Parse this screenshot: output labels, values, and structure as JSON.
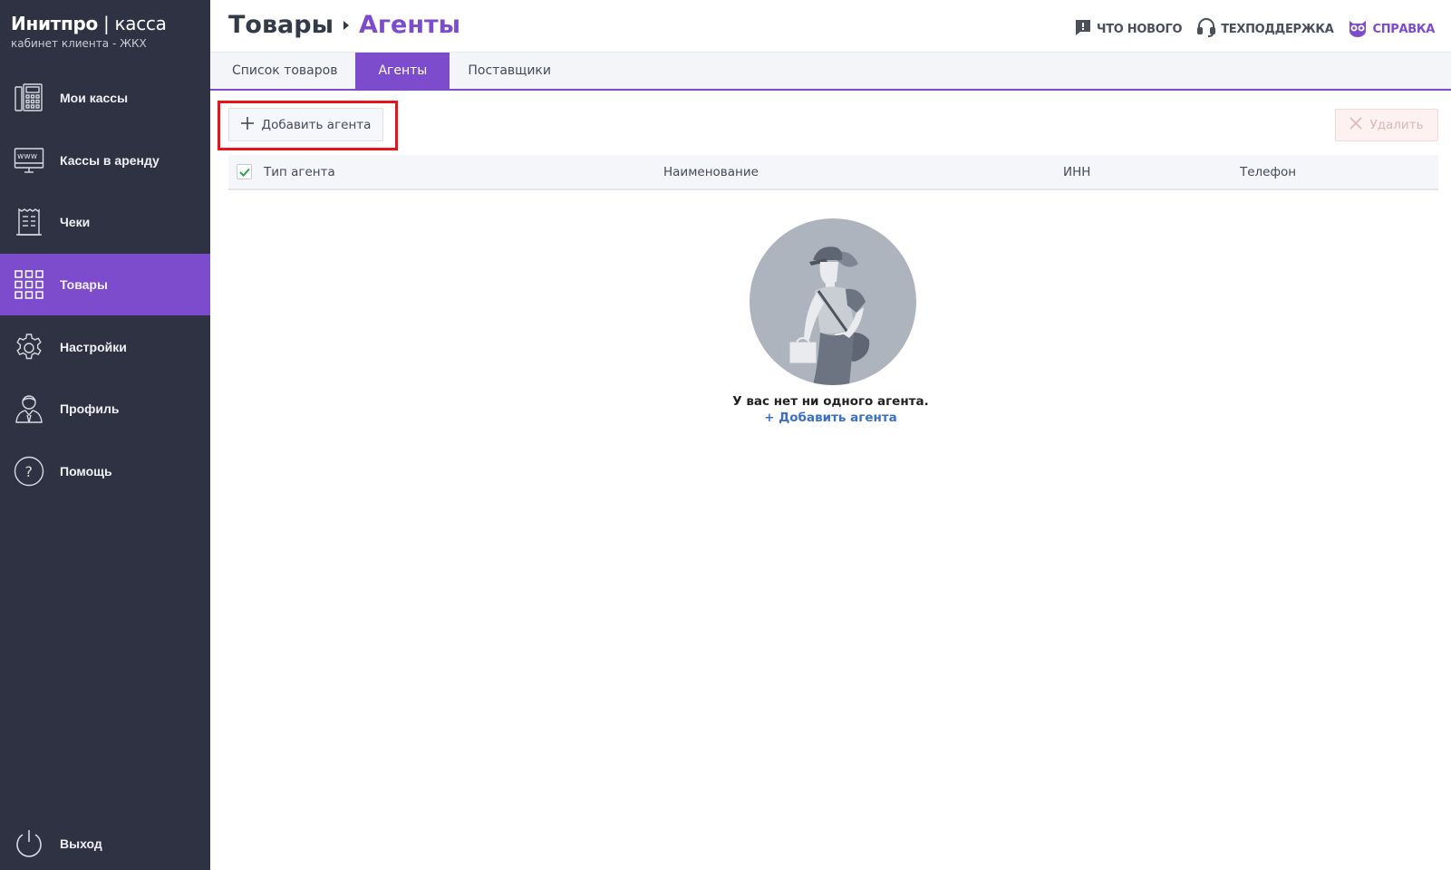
{
  "brand": {
    "title_bold": "Инитпро",
    "separator": " | ",
    "title_thin": "касса",
    "subtitle": "кабинет клиента - ЖКХ"
  },
  "sidebar": {
    "items": [
      {
        "label": "Мои кассы",
        "icon": "cash-register-icon",
        "active": false
      },
      {
        "label": "Кассы в аренду",
        "icon": "www-monitor-icon",
        "active": false
      },
      {
        "label": "Чеки",
        "icon": "receipt-icon",
        "active": false
      },
      {
        "label": "Товары",
        "icon": "grid-icon",
        "active": true
      },
      {
        "label": "Настройки",
        "icon": "gear-icon",
        "active": false
      },
      {
        "label": "Профиль",
        "icon": "user-icon",
        "active": false
      },
      {
        "label": "Помощь",
        "icon": "help-icon",
        "active": false
      }
    ],
    "logout": {
      "label": "Выход",
      "icon": "power-icon"
    }
  },
  "header": {
    "breadcrumb_root": "Товары",
    "breadcrumb_current": "Агенты",
    "links": [
      {
        "label": "ЧТО НОВОГО",
        "icon": "news-icon"
      },
      {
        "label": "ТЕХПОДДЕРЖКА",
        "icon": "headset-icon"
      },
      {
        "label": "СПРАВКА",
        "icon": "owl-icon"
      }
    ]
  },
  "tabs": [
    {
      "label": "Список товаров",
      "active": false
    },
    {
      "label": "Агенты",
      "active": true
    },
    {
      "label": "Поставщики",
      "active": false
    }
  ],
  "toolbar": {
    "add_label": "Добавить агента",
    "delete_label": "Удалить"
  },
  "table": {
    "columns": [
      "Тип агента",
      "Наименование",
      "ИНН",
      "Телефон"
    ],
    "select_all_checked": true
  },
  "empty_state": {
    "message": "У вас нет ни одного агента.",
    "link": "+ Добавить агента"
  },
  "colors": {
    "accent": "#7c4ccc",
    "sidebar_bg": "#2f3242",
    "highlight": "#e8141b",
    "link": "#3a70c8"
  }
}
